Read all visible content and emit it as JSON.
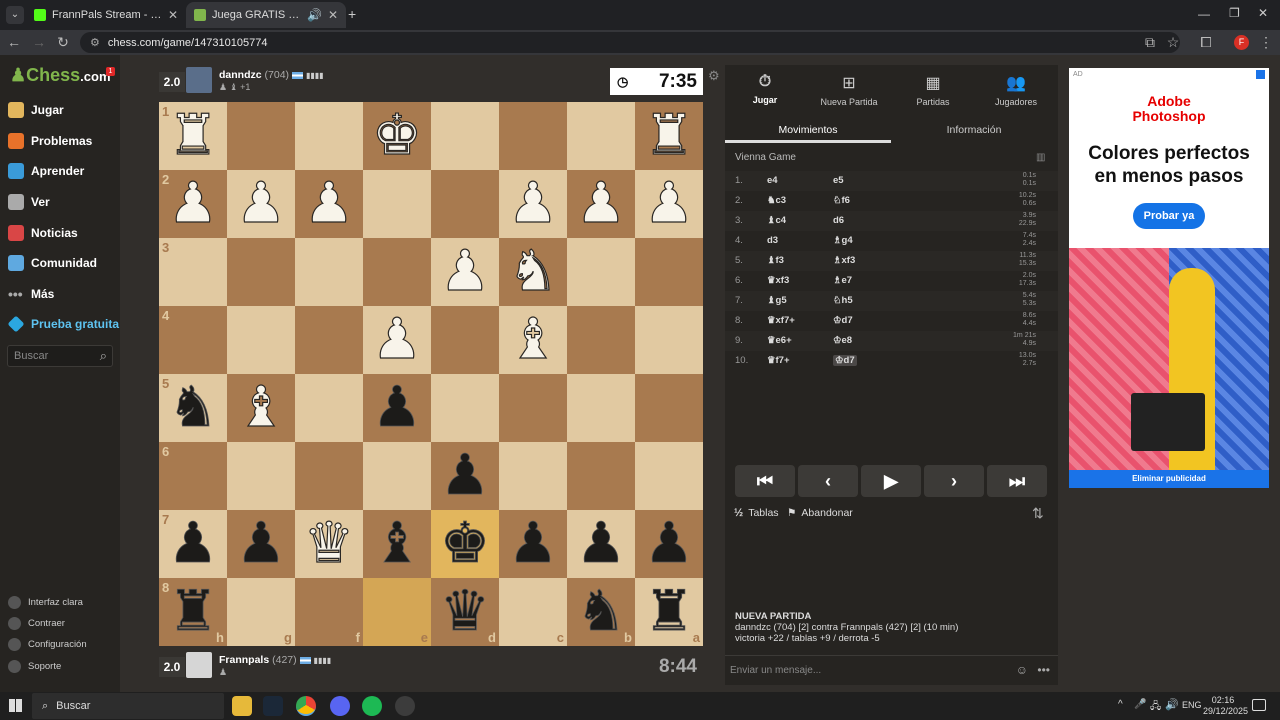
{
  "browser": {
    "tabs": [
      {
        "label": "FrannPals Stream - Watch Live o",
        "active": false
      },
      {
        "label": "Juega GRATIS al ajedrez onl",
        "active": true
      }
    ],
    "url": "chess.com/game/147310105774"
  },
  "sidebar": {
    "logo": "Chess",
    "logo_suffix": ".com",
    "notif_count": "1",
    "items": [
      "Jugar",
      "Problemas",
      "Aprender",
      "Ver",
      "Noticias",
      "Comunidad",
      "Más",
      "Prueba gratuita"
    ],
    "search_placeholder": "Buscar",
    "bottom": [
      "Interfaz clara",
      "Contraer",
      "Configuración",
      "Soporte"
    ]
  },
  "top_player": {
    "score": "2.0",
    "name": "danndzc",
    "rating": "(704)",
    "captured": "+1",
    "clock": "7:35"
  },
  "bottom_player": {
    "score": "2.0",
    "name": "Frannpals",
    "rating": "(427)",
    "clock": "8:44"
  },
  "board": {
    "ranks": [
      "1",
      "2",
      "3",
      "4",
      "5",
      "6",
      "7",
      "8"
    ],
    "files": [
      "h",
      "g",
      "f",
      "e",
      "d",
      "c",
      "b",
      "a"
    ],
    "squares": [
      [
        "wR",
        "",
        "",
        "wK",
        "",
        "",
        "",
        "wR"
      ],
      [
        "wP",
        "wP",
        "wP",
        "",
        "",
        "wP",
        "wP",
        "wP"
      ],
      [
        "",
        "",
        "",
        "",
        "wP",
        "wN",
        "",
        ""
      ],
      [
        "",
        "",
        "",
        "wP",
        "",
        "wB",
        "",
        ""
      ],
      [
        "bN",
        "wB",
        "",
        "bP",
        "",
        "",
        "",
        ""
      ],
      [
        "",
        "",
        "",
        "",
        "bP",
        "",
        "",
        ""
      ],
      [
        "bP",
        "bP",
        "wQ",
        "bB",
        "bK",
        "bP",
        "bP",
        "bP"
      ],
      [
        "bR",
        "",
        "",
        "",
        "bQ",
        "",
        "bN",
        "bR"
      ]
    ]
  },
  "right_panel": {
    "top_tabs": [
      "Jugar",
      "Nueva Partida",
      "Partidas",
      "Jugadores"
    ],
    "tabs": [
      "Movimientos",
      "Información"
    ],
    "opening": "Vienna Game",
    "moves": [
      {
        "n": "1.",
        "w": "e4",
        "b": "e5",
        "t": [
          "0.1s",
          "0.1s"
        ]
      },
      {
        "n": "2.",
        "w": "♞c3",
        "b": "♘f6",
        "t": [
          "10.2s",
          "0.6s"
        ]
      },
      {
        "n": "3.",
        "w": "♝c4",
        "b": "d6",
        "t": [
          "3.9s",
          "22.9s"
        ]
      },
      {
        "n": "4.",
        "w": "d3",
        "b": "♗g4",
        "t": [
          "7.4s",
          "2.4s"
        ]
      },
      {
        "n": "5.",
        "w": "♝f3",
        "b": "♗xf3",
        "t": [
          "11.3s",
          "15.3s"
        ]
      },
      {
        "n": "6.",
        "w": "♛xf3",
        "b": "♗e7",
        "t": [
          "2.0s",
          "17.3s"
        ]
      },
      {
        "n": "7.",
        "w": "♝g5",
        "b": "♘h5",
        "t": [
          "5.4s",
          "5.3s"
        ]
      },
      {
        "n": "8.",
        "w": "♛xf7+",
        "b": "♔d7",
        "t": [
          "8.6s",
          "4.4s"
        ]
      },
      {
        "n": "9.",
        "w": "♛e6+",
        "b": "♔e8",
        "t": [
          "1m 21s",
          "4.9s"
        ]
      },
      {
        "n": "10.",
        "w": "♛f7+",
        "b": "♔d7",
        "t": [
          "13.0s",
          "2.7s"
        ]
      }
    ],
    "controls": [
      "⏮",
      "‹",
      "▶",
      "›",
      "⏭"
    ],
    "draw": "Tablas",
    "resign": "Abandonar",
    "new_game_title": "NUEVA PARTIDA",
    "new_game_line": "danndzc (704) [2] contra Frannpals (427) [2] (10 min)",
    "record": "victoria +22 / tablas +9 / derrota -5",
    "message_placeholder": "Enviar un mensaje..."
  },
  "ad": {
    "tag": "AD",
    "brand": "Adobe\nPhotoshop",
    "headline": "Colores perfectos en menos pasos",
    "cta": "Probar ya",
    "remove": "Eliminar publicidad"
  },
  "taskbar": {
    "search": "Buscar",
    "lang": "ENG",
    "time": "02:16",
    "date": "29/12/2025"
  }
}
